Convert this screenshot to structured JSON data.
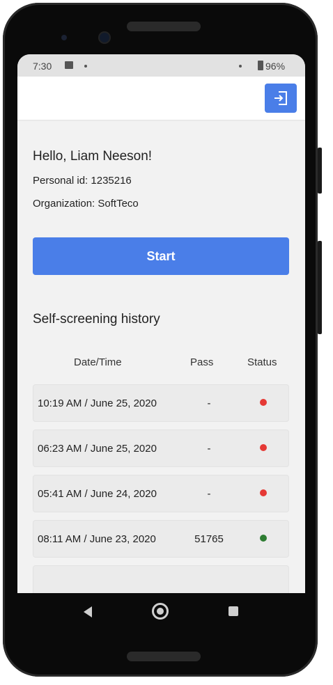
{
  "status_bar": {
    "time": "7:30",
    "battery": "96%",
    "icons": [
      "image-icon",
      "notification-dot-icon",
      "wifi-dot-icon",
      "battery-icon"
    ]
  },
  "app_bar": {
    "logout_icon": "logout-icon",
    "accent_color": "#4a7ee8"
  },
  "profile": {
    "greeting": "Hello, Liam Neeson!",
    "personal_id": "Personal id: 1235216",
    "organization": "Organization: SoftTeco"
  },
  "start_button": {
    "label": "Start"
  },
  "history": {
    "title": "Self-screening history",
    "columns": [
      "Date/Time",
      "Pass",
      "Status"
    ],
    "rows": [
      {
        "datetime": "10:19 AM / June 25, 2020",
        "pass": "-",
        "status": "red",
        "status_color": "#e53935"
      },
      {
        "datetime": "06:23 AM / June 25, 2020",
        "pass": "-",
        "status": "red",
        "status_color": "#e53935"
      },
      {
        "datetime": "05:41 AM / June 24, 2020",
        "pass": "-",
        "status": "red",
        "status_color": "#e53935"
      },
      {
        "datetime": "08:11 AM / June 23, 2020",
        "pass": "51765",
        "status": "green",
        "status_color": "#2e7d32"
      }
    ]
  },
  "nav_bar": {
    "icons": [
      "back-icon",
      "home-icon",
      "recents-icon"
    ]
  }
}
